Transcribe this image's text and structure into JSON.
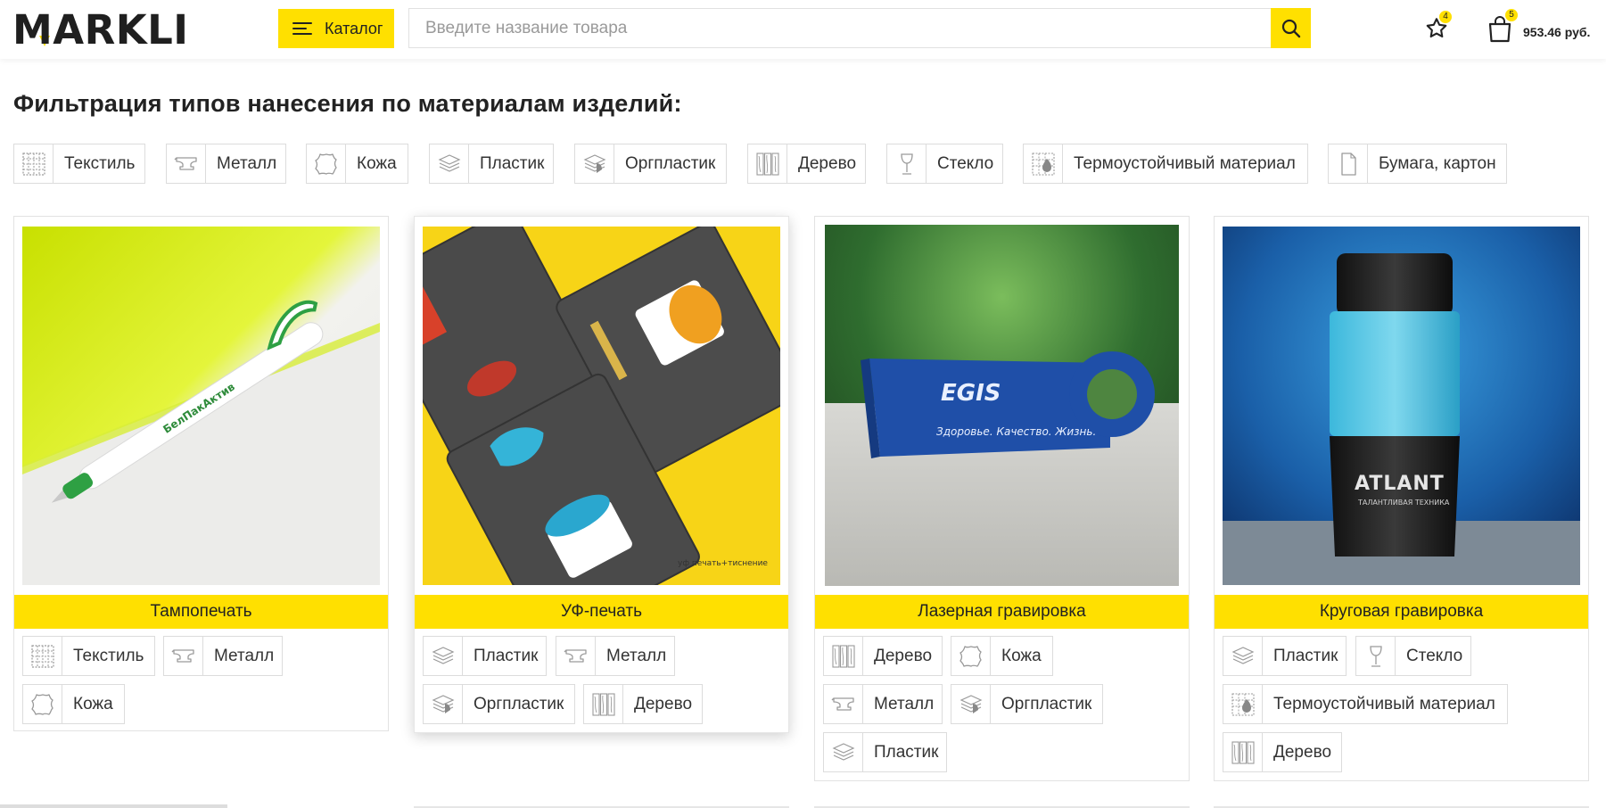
{
  "header": {
    "logo": "MARKLI",
    "catalog_label": "Каталог",
    "search_placeholder": "Введите название товара",
    "favorites_count": "4",
    "cart_count": "5",
    "cart_total": "953.46 руб."
  },
  "page_title": "Фильтрация типов нанесения по материалам изделий:",
  "materials": [
    {
      "label": "Текстиль",
      "icon": "textile-icon"
    },
    {
      "label": "Металл",
      "icon": "anvil-icon"
    },
    {
      "label": "Кожа",
      "icon": "leather-icon"
    },
    {
      "label": "Пластик",
      "icon": "plastic-layers-icon"
    },
    {
      "label": "Оргпластик",
      "icon": "orgplastic-icon"
    },
    {
      "label": "Дерево",
      "icon": "wood-icon"
    },
    {
      "label": "Стекло",
      "icon": "wine-glass-icon"
    },
    {
      "label": "Термоустойчивый материал",
      "icon": "thermo-icon"
    },
    {
      "label": "Бумага, картон",
      "icon": "paper-icon"
    }
  ],
  "methods": [
    {
      "title": "Тампопечать",
      "image": "pen-photo",
      "image_texts": [
        "БелПакАктив"
      ],
      "materials": [
        "Текстиль",
        "Металл",
        "Кожа"
      ]
    },
    {
      "title": "УФ-печать",
      "image": "notebooks-photo",
      "image_texts": [
        "уф печать+тиснение"
      ],
      "materials": [
        "Пластик",
        "Металл",
        "Оргпластик",
        "Дерево"
      ]
    },
    {
      "title": "Лазерная гравировка",
      "image": "usb-drive-photo",
      "image_texts": [
        "EGIS",
        "Здоровье. Качество. Жизнь."
      ],
      "materials": [
        "Дерево",
        "Кожа",
        "Металл",
        "Оргпластик",
        "Пластик"
      ]
    },
    {
      "title": "Круговая гравировка",
      "image": "thermo-mug-photo",
      "image_texts": [
        "ATLANT",
        "ТАЛАНТЛИВАЯ ТЕХНИКА"
      ],
      "materials": [
        "Пластик",
        "Стекло",
        "Термоустойчивый материал",
        "Дерево"
      ]
    }
  ],
  "colors": {
    "accent": "#ffe000",
    "text": "#222222",
    "border": "#dcdcdc"
  }
}
